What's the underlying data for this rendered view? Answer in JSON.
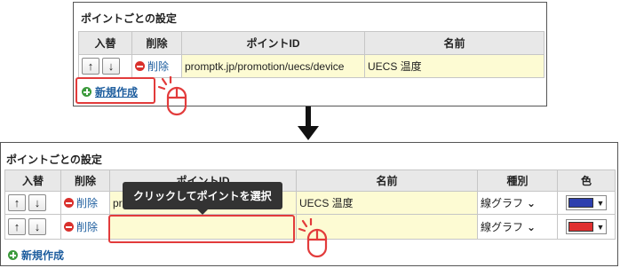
{
  "top": {
    "title": "ポイントごとの設定",
    "headers": [
      "入替",
      "削除",
      "ポイントID",
      "名前"
    ],
    "rows": [
      {
        "delete_label": "削除",
        "point_id": "promptk.jp/promotion/uecs/device",
        "name": "UECS 温度"
      }
    ],
    "add_label": "新規作成"
  },
  "bottom": {
    "title": "ポイントごとの設定",
    "headers": [
      "入替",
      "削除",
      "ポイントID",
      "名前",
      "種別",
      "色"
    ],
    "rows": [
      {
        "delete_label": "削除",
        "point_id": "promptk.jp/promotion/uecs/device",
        "name": "UECS 温度",
        "kind": "線グラフ",
        "color": "#2d3fae"
      },
      {
        "delete_label": "削除",
        "point_id": "",
        "name": "",
        "kind": "線グラフ",
        "color": "#e03030"
      }
    ],
    "add_label": "新規作成",
    "tooltip": "クリックしてポイントを選択"
  },
  "icons": {
    "up": "↑",
    "down": "↓",
    "dropdown": "▼",
    "chevron": "⌄"
  },
  "colors": {
    "highlight": "#e23b3b",
    "link": "#1d5d9e",
    "cell_yellow": "#fdfbd3"
  }
}
